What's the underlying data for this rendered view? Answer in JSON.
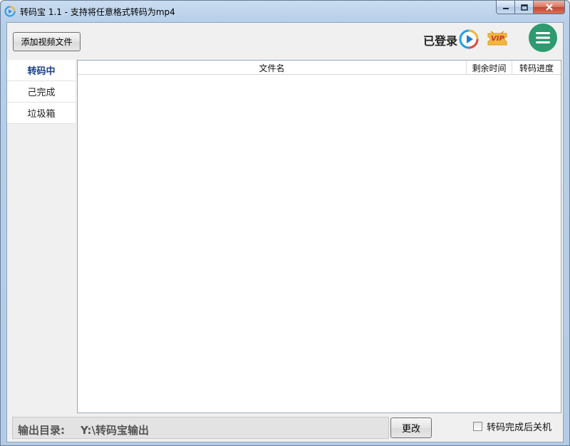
{
  "window": {
    "title": "转码宝 1.1 - 支持将任意格式转码为mp4"
  },
  "toolbar": {
    "add_button": "添加视频文件",
    "logged_in": "已登录",
    "vip_label": "VIP"
  },
  "sidebar": {
    "items": [
      {
        "label": "转码中",
        "active": true
      },
      {
        "label": "己完成",
        "active": false
      },
      {
        "label": "垃圾箱",
        "active": false
      }
    ]
  },
  "table": {
    "columns": [
      "文件名",
      "剩余时间",
      "转码进度"
    ],
    "rows": []
  },
  "footer": {
    "output_label": "输出目录:",
    "output_path": "Y:\\转码宝输出",
    "change_button": "更改",
    "shutdown_label": "转码完成后关机",
    "shutdown_checked": false
  },
  "colors": {
    "accent_green": "#2e9a70",
    "play_blue": "#1e7fd6",
    "vip_gold": "#f2b640",
    "active_tab": "#1a3e8a"
  }
}
